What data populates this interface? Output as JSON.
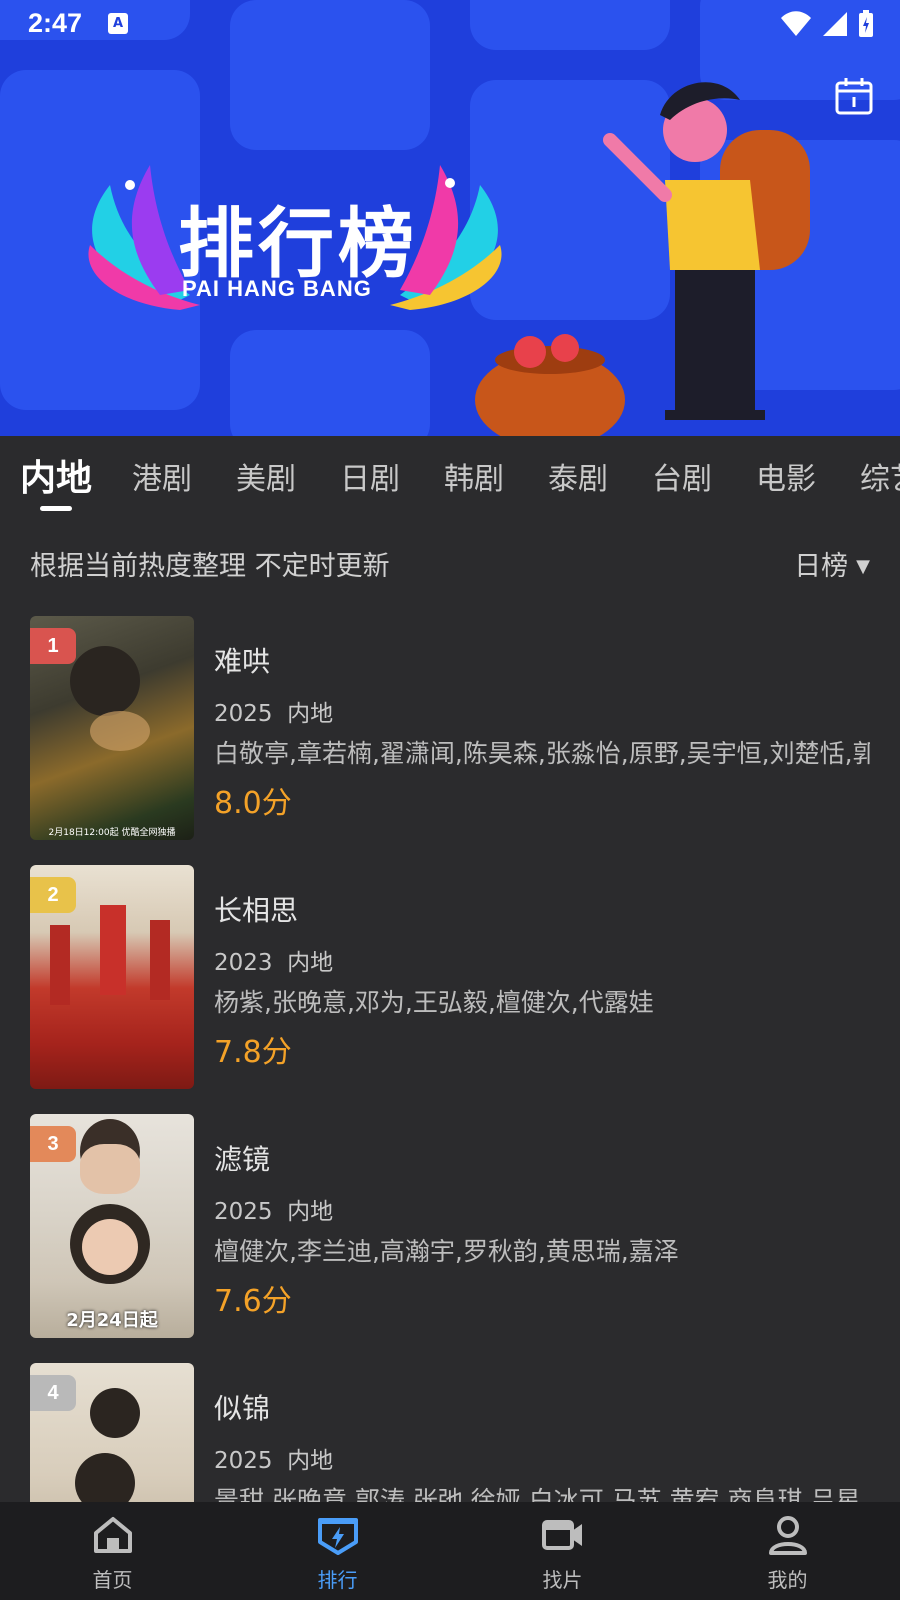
{
  "status_bar": {
    "time": "2:47",
    "notification_icon": "A"
  },
  "banner": {
    "title": "排行榜",
    "subtitle": "PAI HANG BANG"
  },
  "tabs": [
    {
      "label": "内地",
      "active": true
    },
    {
      "label": "港剧"
    },
    {
      "label": "美剧"
    },
    {
      "label": "日剧"
    },
    {
      "label": "韩剧"
    },
    {
      "label": "泰剧"
    },
    {
      "label": "台剧"
    },
    {
      "label": "电影"
    },
    {
      "label": "综艺"
    }
  ],
  "subheader": {
    "text": "根据当前热度整理 不定时更新",
    "sort_label": "日榜",
    "sort_caret": "▼"
  },
  "items": [
    {
      "rank": "1",
      "title": "难哄",
      "year": "2025",
      "region": "内地",
      "cast": "白敬亭,章若楠,翟潇闻,陈昊森,张淼怡,原野,吴宇恒,刘楚恬,郭",
      "score": "8.0分",
      "poster_caption": "2月18日12:00起 优酷全网独播",
      "rank_color": "#d9544f"
    },
    {
      "rank": "2",
      "title": "长相思",
      "year": "2023",
      "region": "内地",
      "cast": "杨紫,张晚意,邓为,王弘毅,檀健次,代露娃",
      "score": "7.8分",
      "poster_caption": "",
      "rank_color": "#e8c24a"
    },
    {
      "rank": "3",
      "title": "滤镜",
      "year": "2025",
      "region": "内地",
      "cast": "檀健次,李兰迪,高瀚宇,罗秋韵,黄思瑞,嘉泽",
      "score": "7.6分",
      "poster_caption": "2月24日起",
      "rank_color": "#e3895a"
    },
    {
      "rank": "4",
      "title": "似锦",
      "year": "2025",
      "region": "内地",
      "cast": "景甜,张晚意,郭涛,张弛,徐娅,白冰可,马苏,黄宥,商阜琪,吕星",
      "score": "",
      "poster_caption": "",
      "rank_color": "#b9b9b9"
    }
  ],
  "bottom_nav": [
    {
      "label": "首页",
      "icon": "home-icon"
    },
    {
      "label": "排行",
      "icon": "ranking-icon",
      "active": true
    },
    {
      "label": "找片",
      "icon": "video-camera-icon"
    },
    {
      "label": "我的",
      "icon": "person-icon"
    }
  ],
  "colors": {
    "banner_bg": "#1f3fdc",
    "page_bg": "#2b2b2d",
    "score": "#f4a228",
    "nav_active": "#4a9df8"
  }
}
